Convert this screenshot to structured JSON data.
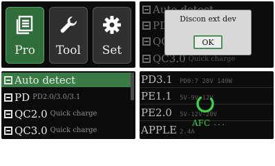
{
  "menu": {
    "tiles": [
      {
        "label": "Pro",
        "icon": "list-icon",
        "active": true
      },
      {
        "label": "Tool",
        "icon": "wrench-icon",
        "active": false
      },
      {
        "label": "Set",
        "icon": "gear-icon",
        "active": false
      }
    ]
  },
  "dialog_panel": {
    "background_rows": [
      {
        "name": "Auto detect",
        "desc": ""
      },
      {
        "name": "PD",
        "desc": ""
      },
      {
        "name": "QC2.0",
        "desc": ""
      },
      {
        "name": "QC3.0",
        "desc": "Quick charge"
      }
    ],
    "dialog": {
      "title": "Discon ext dev",
      "ok_label": "OK"
    }
  },
  "protocol_list": {
    "rows": [
      {
        "name": "Auto detect",
        "desc": "",
        "selected": true
      },
      {
        "name": "PD",
        "desc": "PD2.0/3.0/3.1",
        "selected": false
      },
      {
        "name": "QC2.0",
        "desc": "Quick charge",
        "selected": false
      },
      {
        "name": "QC3.0",
        "desc": "Quick charge",
        "selected": false
      }
    ]
  },
  "detect_panel": {
    "rows": [
      {
        "name": "PD3.1",
        "desc": "PD0:7 28V 140W"
      },
      {
        "name": "PE1.1",
        "desc": "5V-9V-12V"
      },
      {
        "name": "PE2.0",
        "desc": "5V-12V-20V"
      },
      {
        "name": "APPLE",
        "desc": "2.4A"
      }
    ],
    "status": "AFC",
    "status_suffix": "..."
  },
  "colors": {
    "accent_green": "#3a7a45",
    "afc_green": "#3bd04b"
  }
}
